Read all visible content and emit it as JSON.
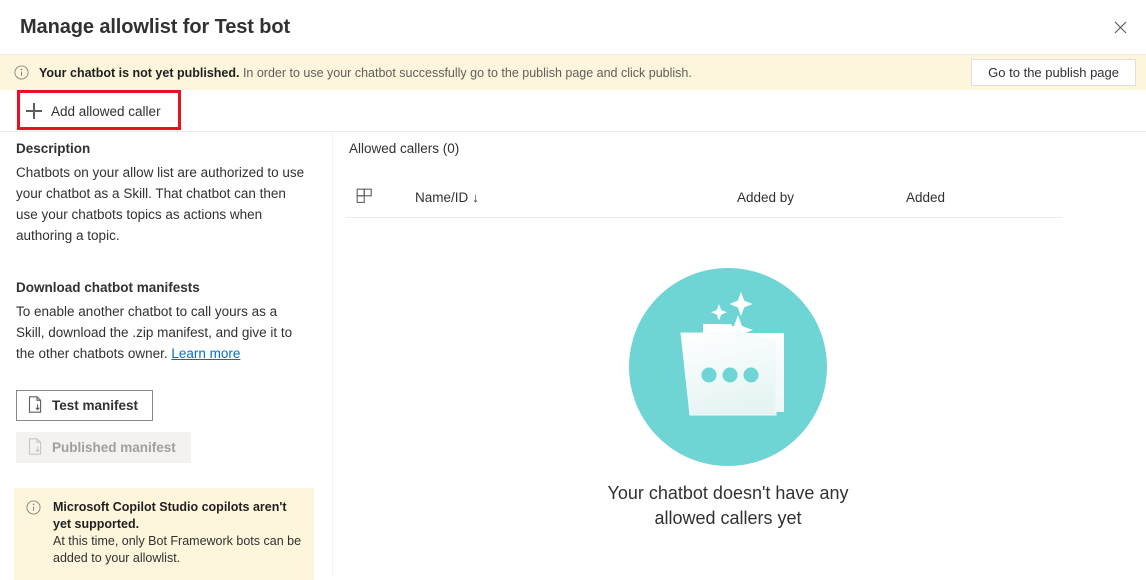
{
  "dialog": {
    "title": "Manage allowlist for Test bot",
    "close_icon": "close-icon"
  },
  "banner": {
    "icon": "info-icon",
    "bold_text": "Your chatbot is not yet published.",
    "text": " In order to use your chatbot successfully go to the publish page and click publish.",
    "action_label": "Go to the publish page",
    "background_color": "#fdf6dd"
  },
  "commandbar": {
    "add_caller_label": "Add allowed caller",
    "add_caller_icon": "plus-icon",
    "highlight_color": "#e81123"
  },
  "left_panel": {
    "description_heading": "Description",
    "description_body": "Chatbots on your allow list are authorized to use your chatbot as a Skill. That chatbot can then use your chatbots topics as actions when authoring a topic.",
    "download_heading": "Download chatbot manifests",
    "download_body": "To enable another chatbot to call yours as a Skill, download the .zip manifest, and give it to the other chatbots owner. ",
    "learn_more_label": "Learn more",
    "test_manifest_label": "Test manifest",
    "test_manifest_icon": "document-download-icon",
    "published_manifest_label": "Published manifest",
    "published_manifest_icon": "document-download-icon",
    "warning": {
      "icon": "info-icon",
      "title": "Microsoft Copilot Studio copilots aren't yet supported.",
      "body": "At this time, only Bot Framework bots can be added to your allowlist.",
      "background_color": "#fdf6dd"
    }
  },
  "right_panel": {
    "allowed_callers_title": "Allowed callers (0)",
    "column_picker_icon": "column-picker-icon",
    "columns": [
      {
        "label": "Name/ID",
        "sort_icon": "↓"
      },
      {
        "label": "Added by",
        "sort_icon": ""
      },
      {
        "label": "Added",
        "sort_icon": ""
      }
    ],
    "empty_state": {
      "illustration": "empty-folder-illustration",
      "accent_color": "#6ed4d4",
      "message": "Your chatbot doesn't have any allowed callers yet"
    }
  }
}
